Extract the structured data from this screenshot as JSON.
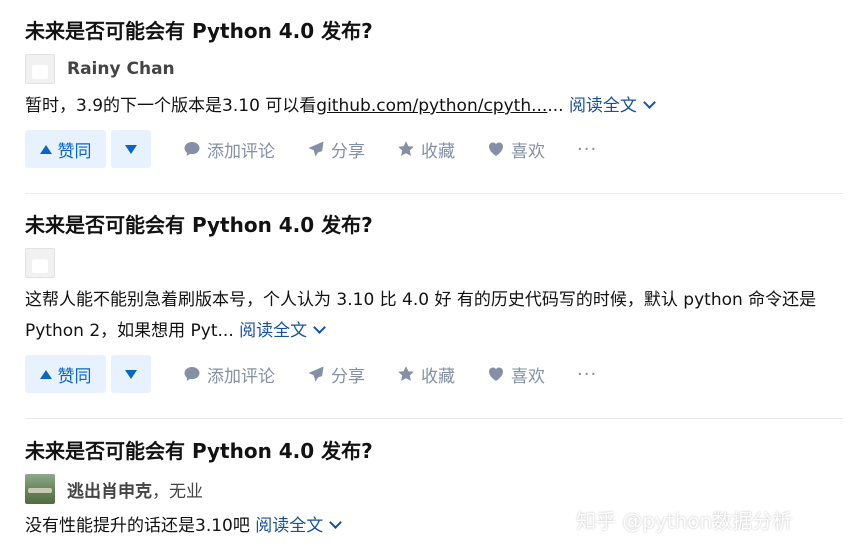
{
  "answers": [
    {
      "question_title": "未来是否可能会有 Python 4.0 发布?",
      "author_name": "Rainy Chan",
      "author_headline": "",
      "excerpt_pre": "暂时，3.9的下一个版本是3.10 可以看",
      "excerpt_link": "github.com/python/cpyth...",
      "excerpt_post": "...",
      "read_more": "阅读全文"
    },
    {
      "question_title": "未来是否可能会有 Python 4.0 发布?",
      "author_name": "",
      "author_headline": "",
      "excerpt_pre": "这帮人能不能别急着刷版本号，个人认为 3.10 比 4.0 好 有的历史代码写的时候，默认 python 命令还是 Python 2，如果想用 Pyt...",
      "read_more": "阅读全文"
    },
    {
      "question_title": "未来是否可能会有 Python 4.0 发布?",
      "author_name": "逃出肖申克",
      "author_headline": "，无业",
      "excerpt_pre": "没有性能提升的话还是3.10吧",
      "read_more": "阅读全文"
    }
  ],
  "actions": {
    "upvote": "赞同",
    "comment": "添加评论",
    "share": "分享",
    "favorite": "收藏",
    "like": "喜欢",
    "more": "···"
  },
  "watermark": "知乎 @python数据分析",
  "colors": {
    "accent": "#0a66c2",
    "vote_bg": "#e8f2fe",
    "link": "#175199",
    "muted": "#8590a6"
  },
  "icons": [
    "triangle-up-icon",
    "triangle-down-icon",
    "comment-icon",
    "share-icon",
    "star-icon",
    "heart-icon",
    "chevron-down-icon",
    "more-icon"
  ]
}
